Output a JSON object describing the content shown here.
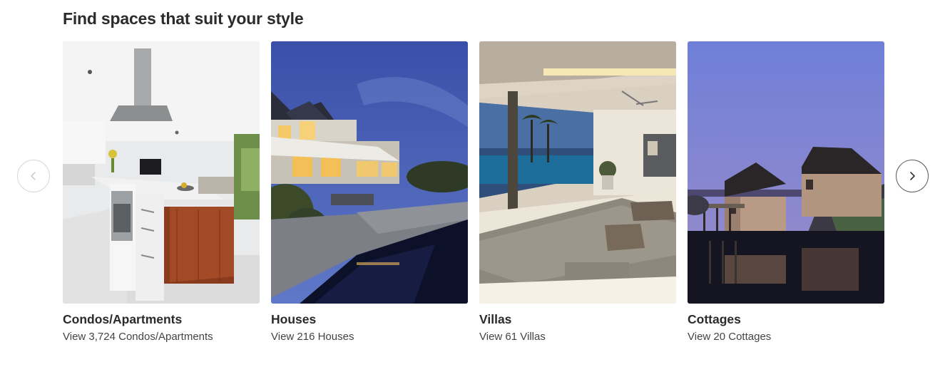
{
  "section": {
    "title": "Find spaces that suit your style"
  },
  "carousel": {
    "prev_icon": "chevron-left-icon",
    "next_icon": "chevron-right-icon",
    "prev_disabled": true
  },
  "cards": [
    {
      "title": "Condos/Apartments",
      "subtitle": "View 3,724 Condos/Apartments",
      "image": "modern-kitchen-photo"
    },
    {
      "title": "Houses",
      "subtitle": "View 216 Houses",
      "image": "house-pool-dusk-photo"
    },
    {
      "title": "Villas",
      "subtitle": "View 61 Villas",
      "image": "villa-living-room-photo"
    },
    {
      "title": "Cottages",
      "subtitle": "View 20 Cottages",
      "image": "waterfront-cottages-photo"
    }
  ],
  "colors": {
    "text": "#2b2b2b",
    "subtext": "#444444",
    "nav_border_disabled": "#d8d8d8",
    "nav_border_active": "#5a5a5a"
  }
}
